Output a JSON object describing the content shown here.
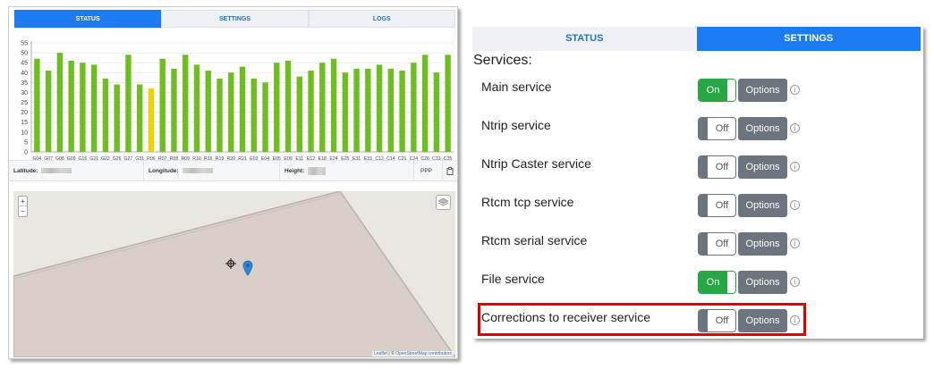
{
  "left_panel": {
    "tabs": [
      {
        "label": "STATUS",
        "active": true
      },
      {
        "label": "SETTINGS",
        "active": false
      },
      {
        "label": "LOGS",
        "active": false
      }
    ],
    "coords": {
      "latitude_label": "Latitude:",
      "longitude_label": "Longitude:",
      "height_label": "Height:",
      "solution": "PPP",
      "copy_icon": "clipboard-icon"
    },
    "map": {
      "zoom_in": "+",
      "zoom_out": "−",
      "attribution_leaflet": "Leaflet",
      "attribution_sep": " | © ",
      "attribution_osm": "OpenStreetMap contributors"
    }
  },
  "chart_data": {
    "type": "bar",
    "categories": [
      "G04",
      "G07",
      "G08",
      "G09",
      "G16",
      "G21",
      "G22",
      "G26",
      "G27",
      "G31",
      "R06",
      "R07",
      "R08",
      "R09",
      "R10",
      "R16",
      "R19",
      "R20",
      "R21",
      "E03",
      "E04",
      "E05",
      "E09",
      "E11",
      "E12",
      "E18",
      "E24",
      "E25",
      "E31",
      "E33",
      "C12",
      "C14",
      "C21",
      "C24",
      "C26",
      "C33",
      "C35"
    ],
    "values": [
      47,
      41,
      50,
      46,
      45,
      44,
      37,
      34,
      49,
      34,
      32,
      47,
      42,
      49,
      44,
      41,
      37,
      40,
      43,
      37,
      35,
      45,
      46,
      38,
      41,
      45,
      47,
      40,
      42,
      42,
      44,
      42,
      41,
      45,
      49,
      40,
      49
    ],
    "highlight_index": 10,
    "bar_color": "#6fbe1f",
    "highlight_color": "#f5d000",
    "y_ticks": [
      0,
      5,
      10,
      15,
      20,
      25,
      30,
      35,
      40,
      45,
      50,
      55
    ],
    "ylim": [
      0,
      55
    ],
    "grid": true
  },
  "right_panel": {
    "tabs": [
      {
        "label": "STATUS",
        "active": false
      },
      {
        "label": "SETTINGS",
        "active": true
      }
    ],
    "title": "Services:",
    "options_label": "Options",
    "info_glyph": "i",
    "services": [
      {
        "label": "Main service",
        "state": "On"
      },
      {
        "label": "Ntrip service",
        "state": "Off"
      },
      {
        "label": "Ntrip Caster service",
        "state": "Off"
      },
      {
        "label": "Rtcm tcp service",
        "state": "Off"
      },
      {
        "label": "Rtcm serial service",
        "state": "Off"
      },
      {
        "label": "File service",
        "state": "On"
      },
      {
        "label": "Corrections to receiver service",
        "state": "Off"
      }
    ],
    "highlight_color": "#e00000"
  }
}
